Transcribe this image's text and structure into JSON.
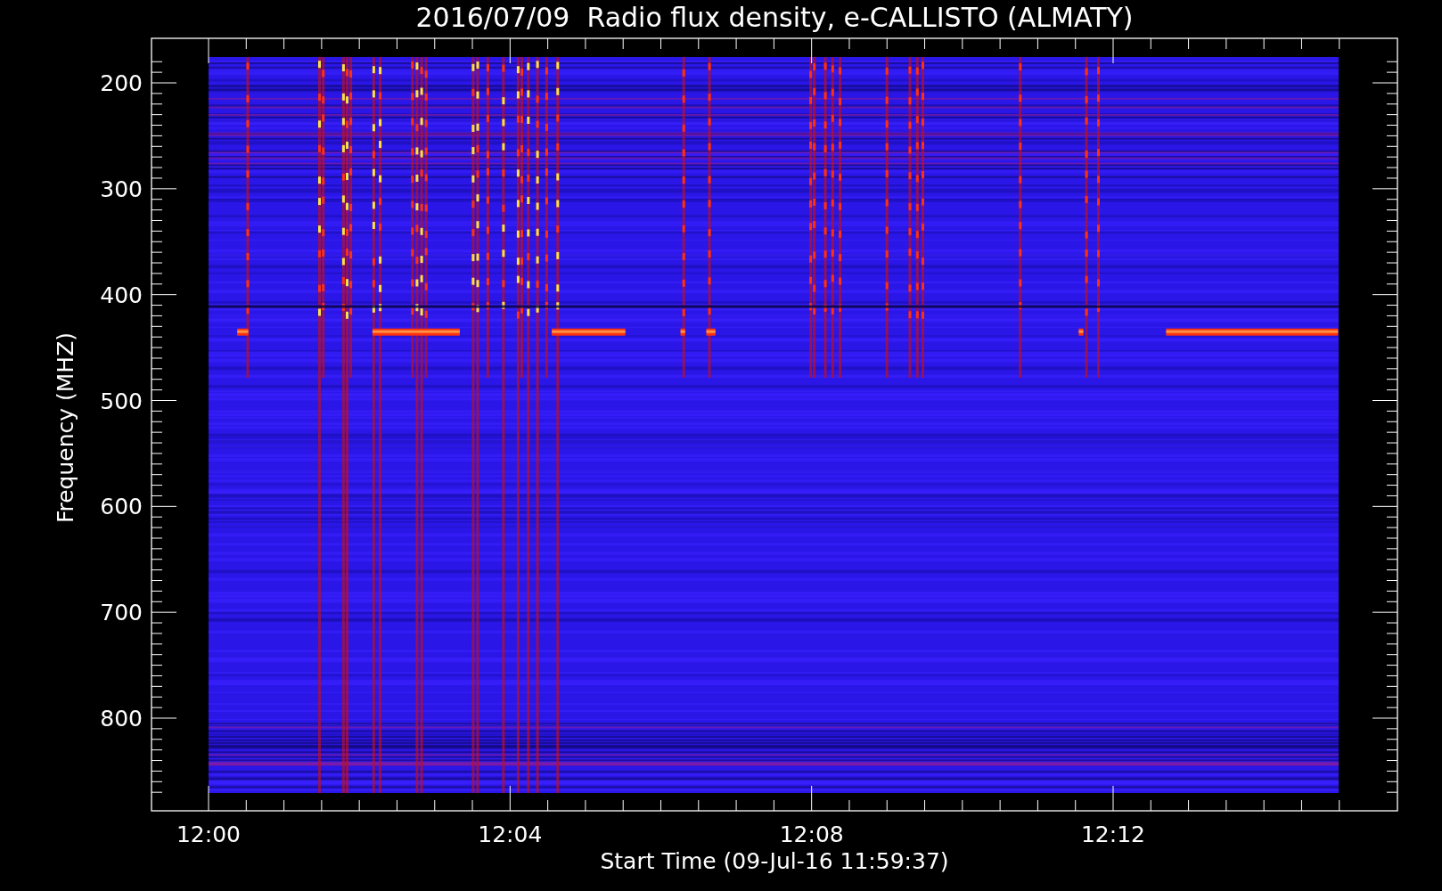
{
  "title": "2016/07/09  Radio flux density, e-CALLISTO (ALMATY)",
  "plot": {
    "ylabel": "Frequency (MHZ)",
    "xlabel": "Start Time (09-Jul-16 11:59:37)",
    "yticks": [
      "200",
      "300",
      "400",
      "500",
      "600",
      "700",
      "800"
    ],
    "xticks": [
      "12:00",
      "12:04",
      "12:08",
      "12:12"
    ]
  }
}
